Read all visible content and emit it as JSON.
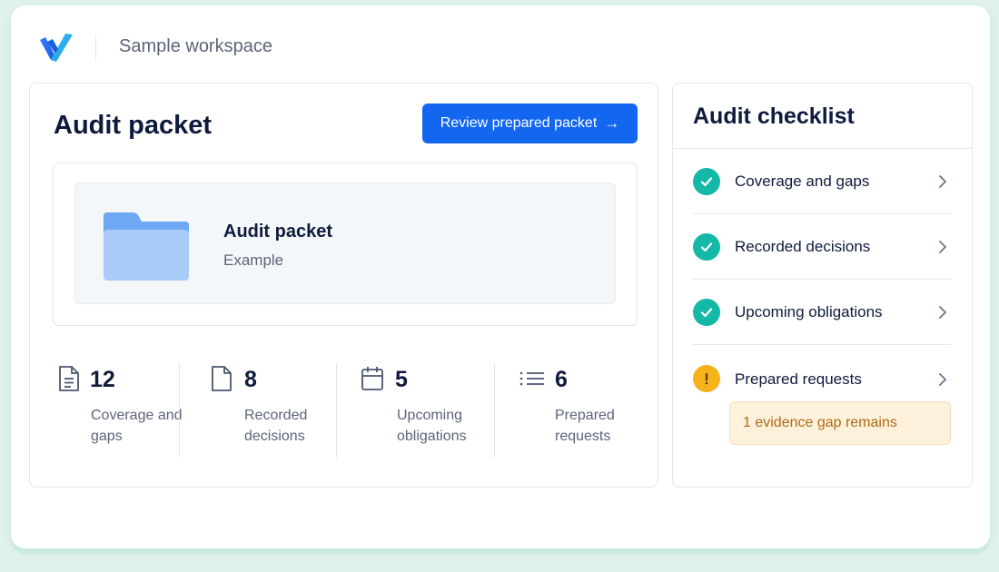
{
  "header": {
    "workspace": "Sample workspace",
    "brand_color": "#1366f0",
    "logo_icon": "brand-logo-icon"
  },
  "main": {
    "title": "Audit packet",
    "primary_button": {
      "label": "Review prepared packet",
      "arrow": "→"
    },
    "preview": {
      "icon": "folder-icon",
      "title": "Audit packet",
      "subtitle": "Example"
    },
    "stats": [
      {
        "icon": "document-lines-icon",
        "value": "12",
        "label": "Coverage and gaps"
      },
      {
        "icon": "document-icon",
        "value": "8",
        "label": "Recorded decisions"
      },
      {
        "icon": "calendar-icon",
        "value": "5",
        "label": "Upcoming obligations"
      },
      {
        "icon": "list-icon",
        "value": "6",
        "label": "Prepared requests"
      }
    ]
  },
  "checklist": {
    "title": "Audit checklist",
    "items": [
      {
        "label": "Coverage and gaps",
        "status": "complete",
        "status_color": "#14b8a6"
      },
      {
        "label": "Recorded decisions",
        "status": "complete",
        "status_color": "#14b8a6"
      },
      {
        "label": "Upcoming obligations",
        "status": "complete",
        "status_color": "#14b8a6"
      },
      {
        "label": "Prepared requests",
        "status": "warning",
        "status_color": "#f5b21b"
      }
    ],
    "warning_note": "1 evidence gap remains"
  }
}
